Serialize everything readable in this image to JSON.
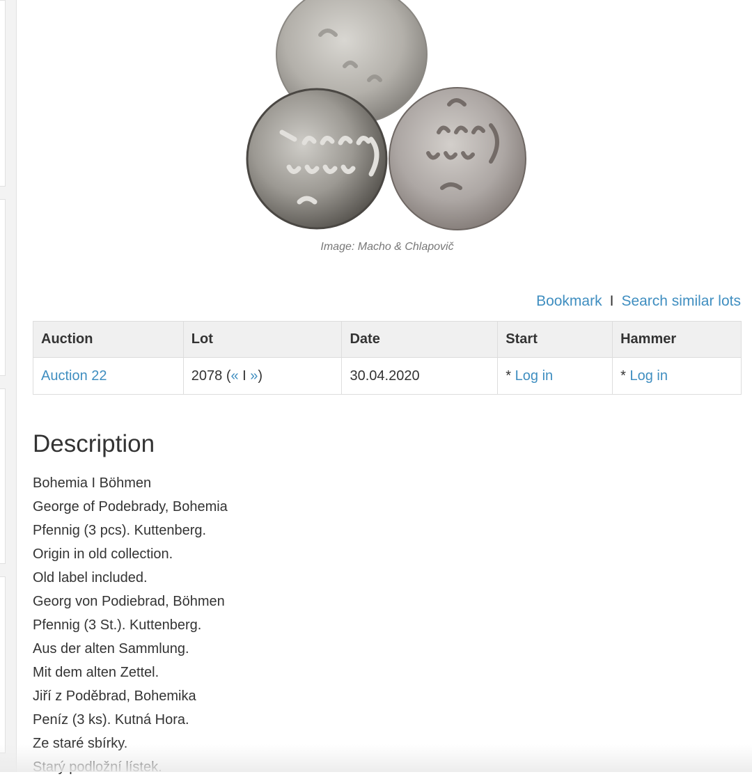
{
  "image": {
    "caption": "Image: Macho & Chlapovič"
  },
  "actions": {
    "bookmark": "Bookmark",
    "separator": "I",
    "search_similar": "Search similar lots"
  },
  "table": {
    "headers": [
      "Auction",
      "Lot",
      "Date",
      "Start",
      "Hammer"
    ],
    "row": {
      "auction": "Auction 22",
      "lot_number": "2078 (",
      "lot_prev": "«",
      "lot_sep": " I ",
      "lot_next": "»",
      "lot_close": ")",
      "date": "30.04.2020",
      "start_prefix": "* ",
      "start_link": "Log in",
      "hammer_prefix": "* ",
      "hammer_link": "Log in"
    }
  },
  "description": {
    "title": "Description",
    "lines": [
      "Bohemia I Böhmen",
      "George of Podebrady, Bohemia",
      "Pfennig (3 pcs). Kuttenberg.",
      "Origin in old collection.",
      "Old label included.",
      "Georg von Podiebrad, Böhmen",
      "Pfennig (3 St.). Kuttenberg.",
      "Aus der alten Sammlung.",
      "Mit dem alten Zettel.",
      "Jiří z Poděbrad, Bohemika",
      "Peníz (3 ks). Kutná Hora.",
      "Ze staré sbírky.",
      "Starý podložní lístek."
    ]
  },
  "colors": {
    "link": "#3f8ec0",
    "text": "#333333",
    "header_bg": "#f0f0f0",
    "caption": "#777777"
  }
}
